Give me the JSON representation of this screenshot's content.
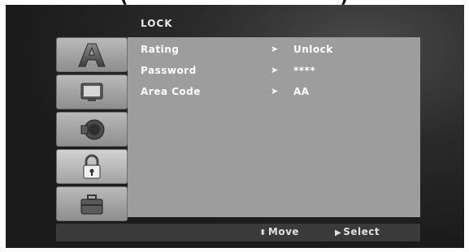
{
  "top_caption": "(                              )",
  "header": {
    "title": "LOCK"
  },
  "tabs": [
    {
      "icon": "letter-a-icon"
    },
    {
      "icon": "monitor-icon"
    },
    {
      "icon": "speaker-icon"
    },
    {
      "icon": "padlock-icon",
      "selected": true
    },
    {
      "icon": "briefcase-icon"
    }
  ],
  "settings": [
    {
      "label": "Rating",
      "value": "Unlock"
    },
    {
      "label": "Password",
      "value": "****"
    },
    {
      "label": "Area Code",
      "value": "AA"
    }
  ],
  "footer": {
    "move_glyph": "⬍",
    "move_label": "Move",
    "select_glyph": "▶",
    "select_label": "Select"
  }
}
